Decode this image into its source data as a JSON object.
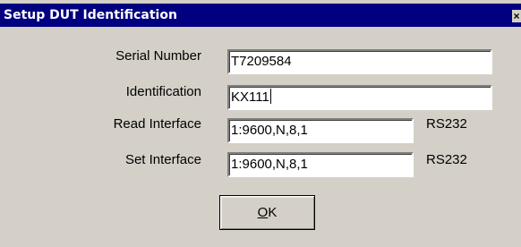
{
  "window": {
    "title": "Setup DUT Identification",
    "close_glyph": "×"
  },
  "fields": {
    "serial_number": {
      "label": "Serial Number",
      "value": "T7209584"
    },
    "identification": {
      "label": "Identification",
      "value": "KX111"
    },
    "read_interface": {
      "label": "Read Interface",
      "value": "1:9600,N,8,1",
      "type": "RS232"
    },
    "set_interface": {
      "label": "Set Interface",
      "value": "1:9600,N,8,1",
      "type": "RS232"
    }
  },
  "buttons": {
    "ok_mnemonic": "O",
    "ok_rest": "K"
  },
  "colors": {
    "titlebar": "#000080",
    "face": "#d4d0c8"
  }
}
